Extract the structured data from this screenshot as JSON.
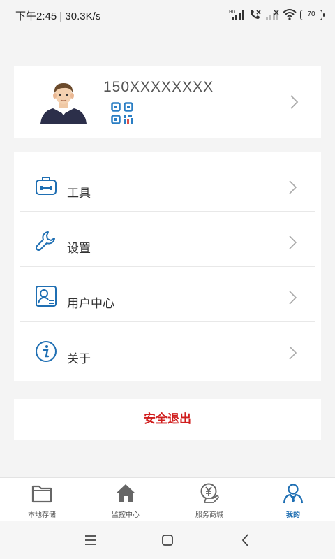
{
  "status_bar": {
    "time": "下午2:45 | 30.3K/s",
    "battery": "70",
    "icons": [
      "hd-signal-icon",
      "call-icon",
      "no-signal-icon",
      "wifi-icon",
      "battery-icon"
    ]
  },
  "profile": {
    "phone": "150XXXXXXXX",
    "avatar": "avatar-man",
    "qr_icon": "qr-code-icon"
  },
  "menu": [
    {
      "label": "工具",
      "icon": "toolbox-icon"
    },
    {
      "label": "设置",
      "icon": "wrench-icon"
    },
    {
      "label": "用户中心",
      "icon": "user-card-icon"
    },
    {
      "label": "关于",
      "icon": "info-icon"
    }
  ],
  "logout_label": "安全退出",
  "tabs": [
    {
      "label": "本地存储",
      "icon": "folder-icon",
      "active": false
    },
    {
      "label": "监控中心",
      "icon": "home-icon",
      "active": false
    },
    {
      "label": "服务商城",
      "icon": "yen-hand-icon",
      "active": false
    },
    {
      "label": "我的",
      "icon": "person-icon",
      "active": true
    }
  ],
  "colors": {
    "accent": "#1f6fb3",
    "logout": "#d01e1e",
    "background": "#f4f4f4"
  }
}
